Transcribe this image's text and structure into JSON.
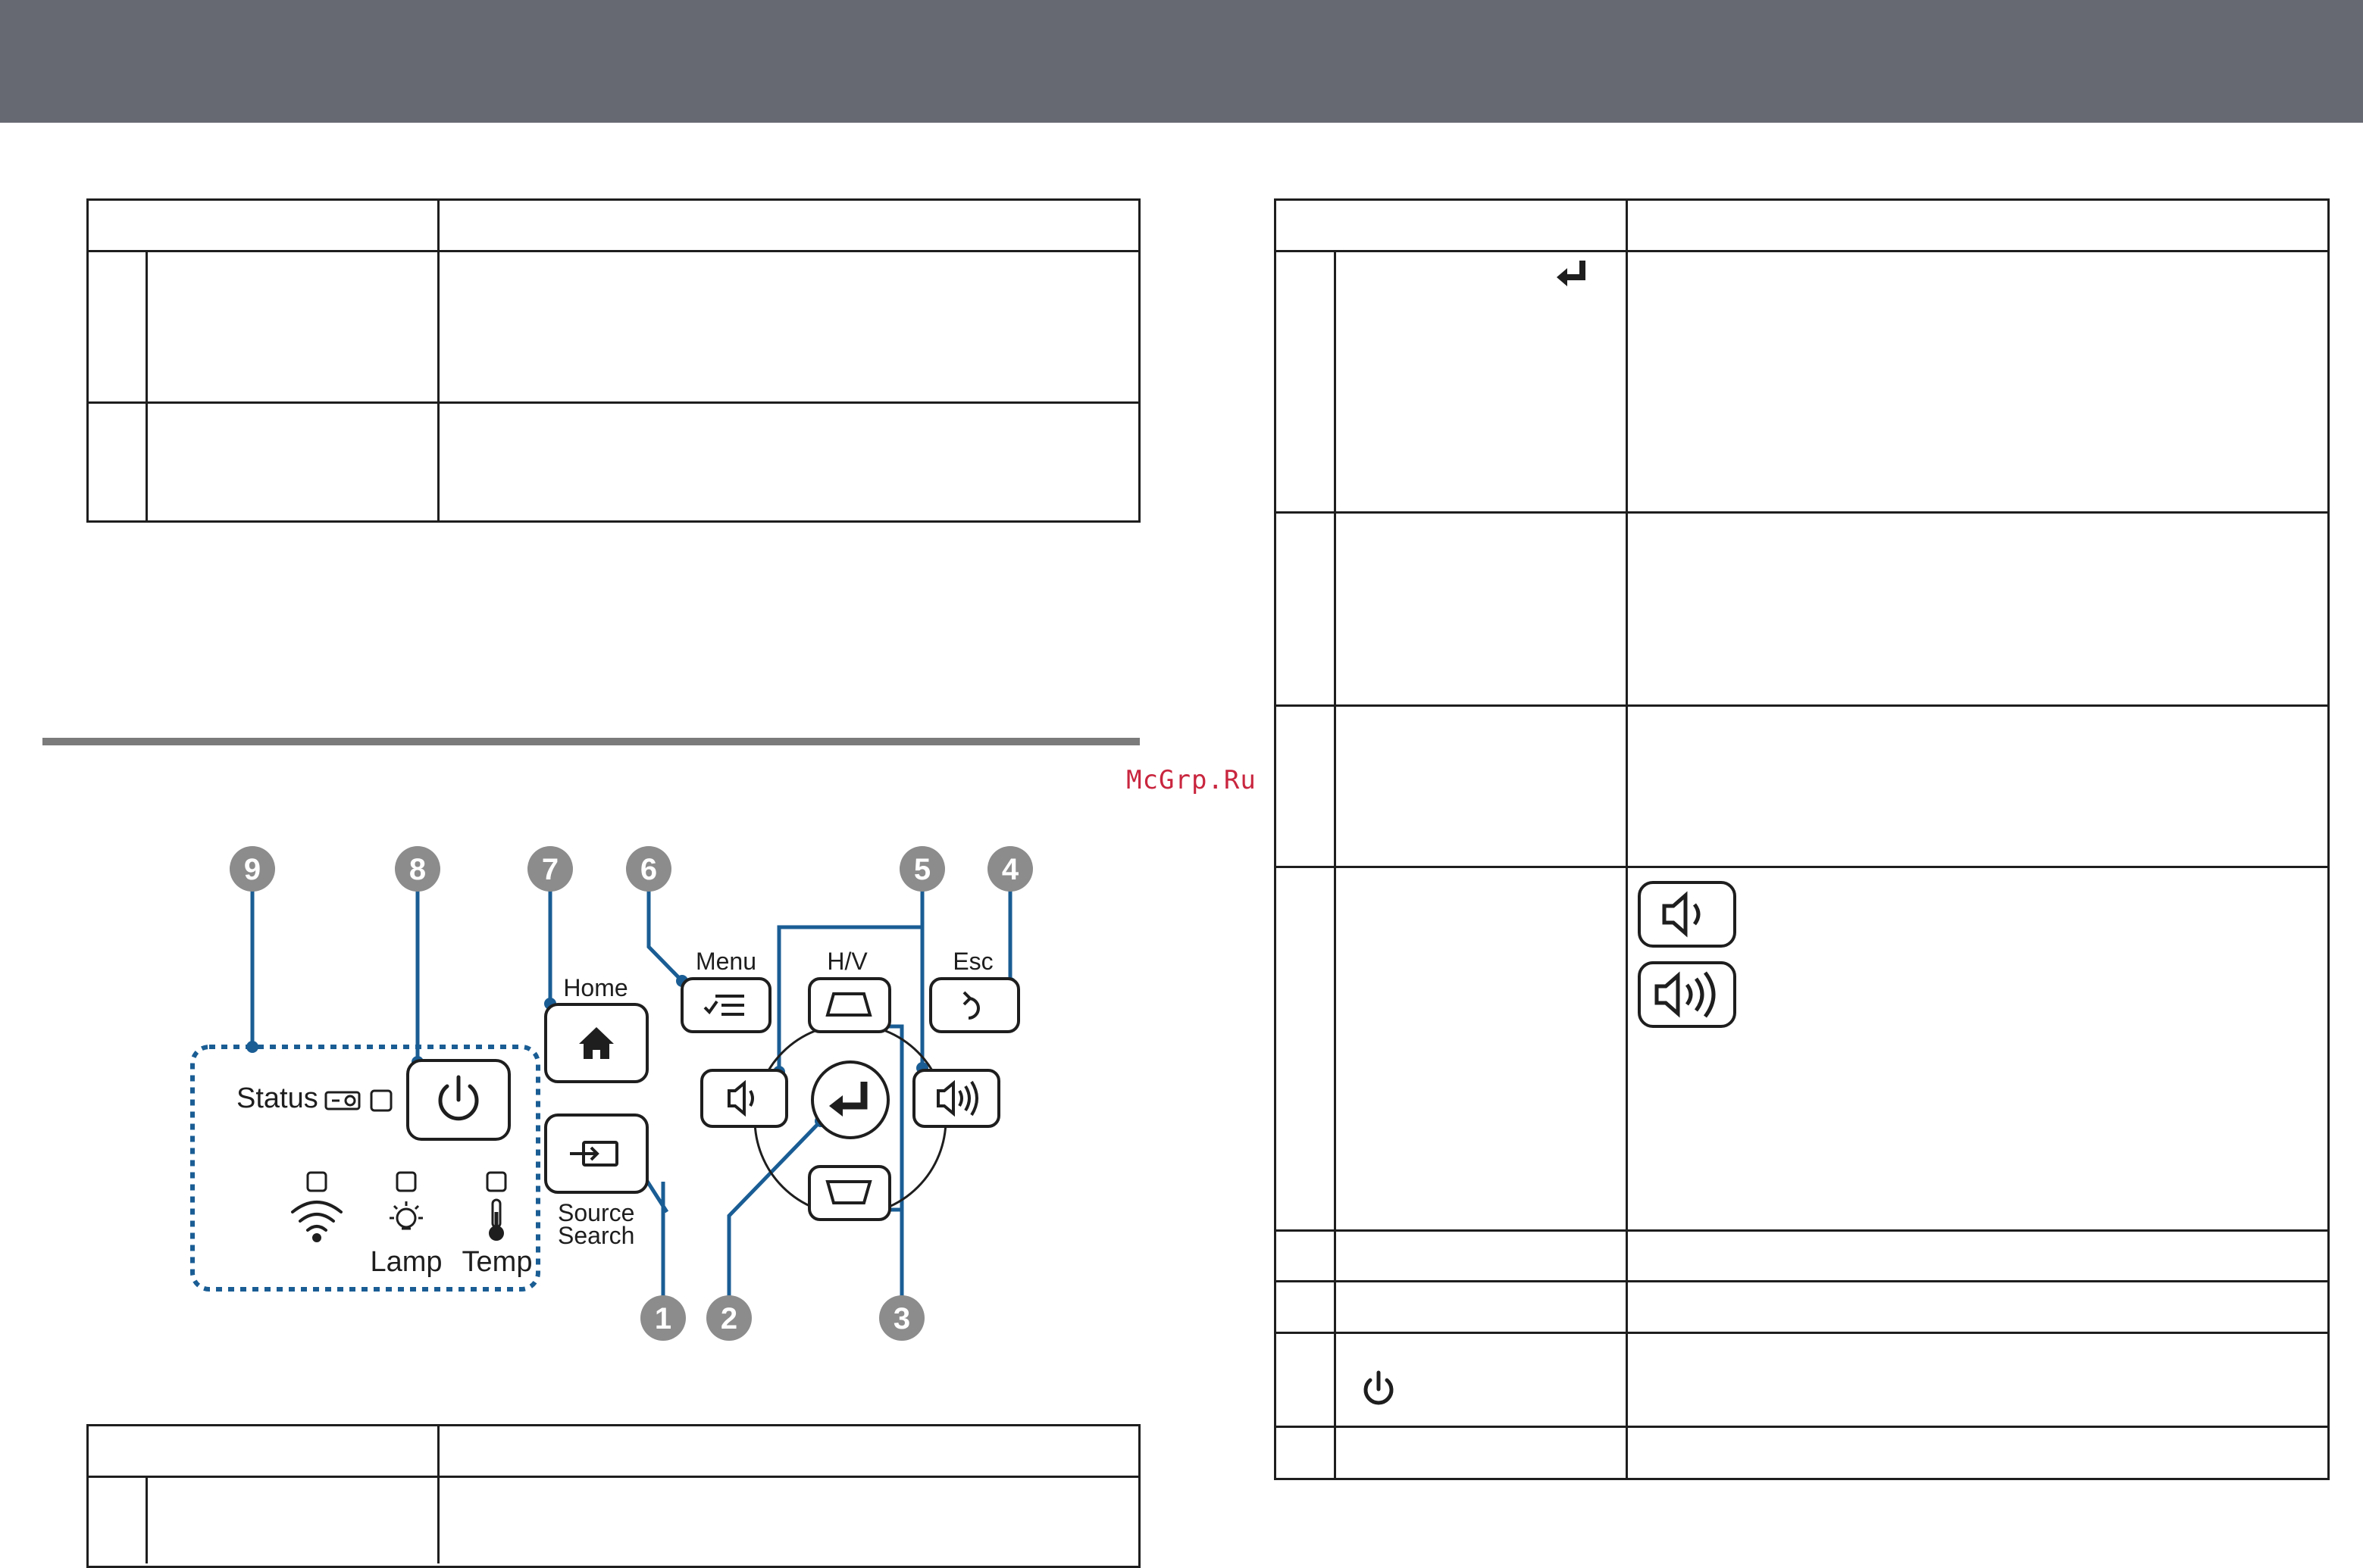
{
  "watermark": "McGrp.Ru",
  "callouts": [
    "9",
    "8",
    "7",
    "6",
    "5",
    "4",
    "1",
    "2",
    "3"
  ],
  "panel": {
    "menu_label": "Menu",
    "hv_label": "H/V",
    "esc_label": "Esc",
    "home_label": "Home",
    "status_label": "Status",
    "source_label_line1": "Source",
    "source_label_line2": "Search",
    "lamp_label": "Lamp",
    "temp_label": "Temp"
  },
  "icons": [
    "enter-icon",
    "volume-down-icon",
    "volume-up-icon",
    "power-icon",
    "home-icon",
    "menu-icon",
    "esc-icon",
    "source-icon",
    "wifi-icon",
    "lamp-icon",
    "temp-icon",
    "keystone-icon",
    "projector-icon"
  ],
  "colors": {
    "header_bar": "#676972",
    "callout_fill": "#8c8c8c",
    "leader_line": "#1a5d94",
    "status_dotted": "#1a5d94",
    "watermark": "#c9263f"
  }
}
